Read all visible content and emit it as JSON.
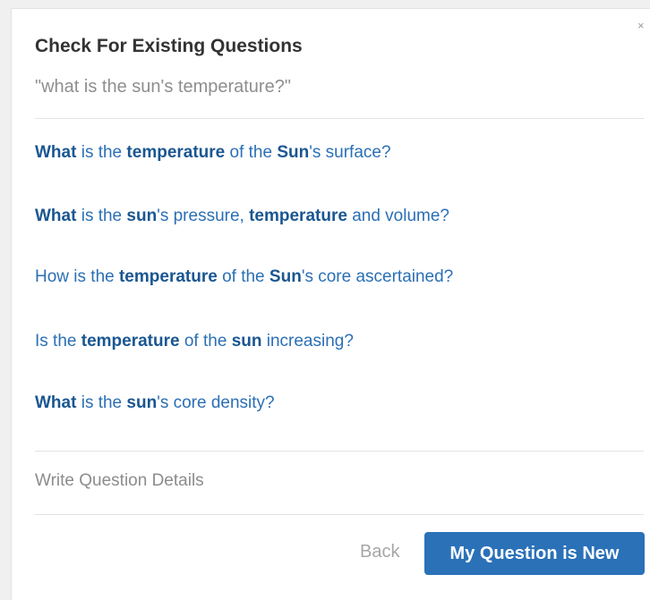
{
  "dialog": {
    "close_glyph": "×",
    "close_icon": "close-icon",
    "title": "Check For Existing Questions",
    "query": "\"what is the sun's temperature?\""
  },
  "questions": [
    {
      "segments": [
        {
          "text": "What",
          "bold": true
        },
        {
          "text": " is the ",
          "bold": false
        },
        {
          "text": "temperature",
          "bold": true
        },
        {
          "text": " of the ",
          "bold": false
        },
        {
          "text": "Sun",
          "bold": true
        },
        {
          "text": "'s surface?",
          "bold": false
        }
      ]
    },
    {
      "segments": [
        {
          "text": "What",
          "bold": true
        },
        {
          "text": " is the ",
          "bold": false
        },
        {
          "text": "sun",
          "bold": true
        },
        {
          "text": "'s pressure, ",
          "bold": false
        },
        {
          "text": "temperature",
          "bold": true
        },
        {
          "text": " and volume?",
          "bold": false
        }
      ]
    },
    {
      "segments": [
        {
          "text": "How is the ",
          "bold": false
        },
        {
          "text": "temperature",
          "bold": true
        },
        {
          "text": " of the ",
          "bold": false
        },
        {
          "text": "Sun",
          "bold": true
        },
        {
          "text": "'s core ascertained?",
          "bold": false
        }
      ]
    },
    {
      "segments": [
        {
          "text": "Is the ",
          "bold": false
        },
        {
          "text": "temperature",
          "bold": true
        },
        {
          "text": " of the ",
          "bold": false
        },
        {
          "text": "sun",
          "bold": true
        },
        {
          "text": " increasing?",
          "bold": false
        }
      ]
    },
    {
      "segments": [
        {
          "text": "What",
          "bold": true
        },
        {
          "text": " is the ",
          "bold": false
        },
        {
          "text": "sun",
          "bold": true
        },
        {
          "text": "'s core density?",
          "bold": false
        }
      ]
    }
  ],
  "details_link": "Write Question Details",
  "actions": {
    "back_label": "Back",
    "new_label": "My Question is New"
  },
  "colors": {
    "link": "#2b6fb5",
    "link_bold": "#1a5691",
    "primary_button": "#2a71b8",
    "muted_text": "#8e8e8e"
  }
}
